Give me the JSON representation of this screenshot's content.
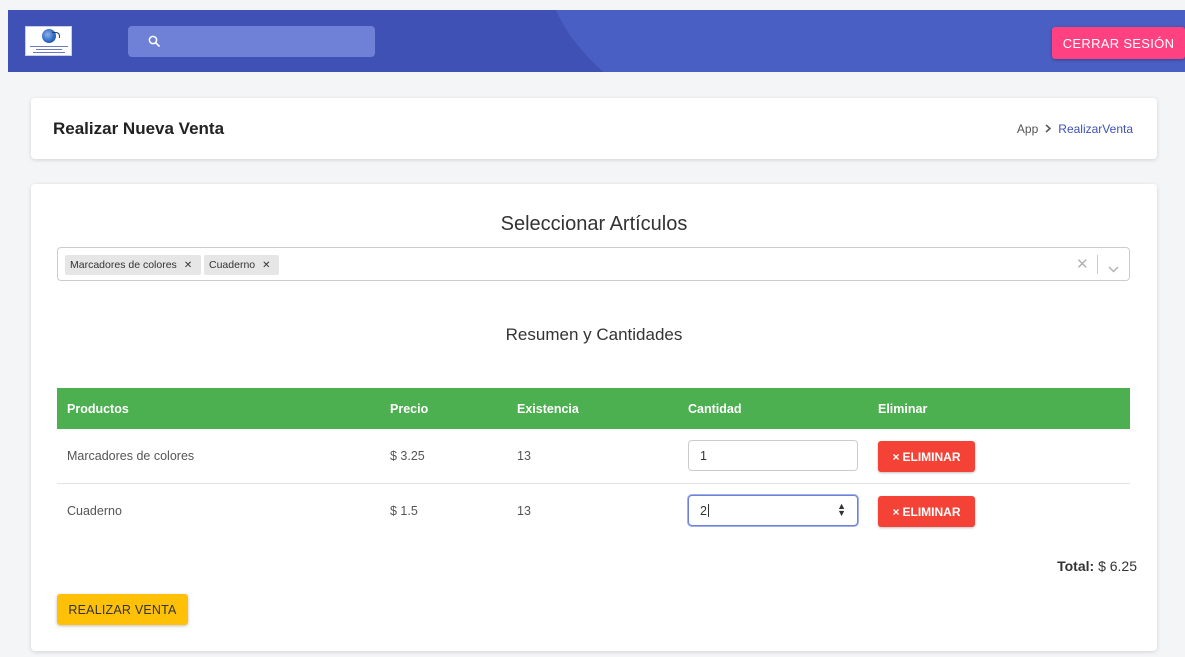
{
  "header": {
    "logout_label": "CERRAR SESIÓN",
    "search_placeholder": "",
    "accent_color": "#3f51b5",
    "logout_color": "#ff4081"
  },
  "page": {
    "title": "Realizar Nueva Venta",
    "breadcrumb": [
      "App",
      "RealizarVenta"
    ]
  },
  "selector": {
    "title": "Seleccionar Artículos",
    "selected": [
      "Marcadores de colores",
      "Cuaderno"
    ]
  },
  "summary": {
    "title": "Resumen y Cantidades",
    "columns": [
      "Productos",
      "Precio",
      "Existencia",
      "Cantidad",
      "Eliminar"
    ],
    "rows": [
      {
        "product": "Marcadores de colores",
        "price": "$ 3.25",
        "stock": "13",
        "quantity": "1",
        "delete_label": "ELIMINAR"
      },
      {
        "product": "Cuaderno",
        "price": "$ 1.5",
        "stock": "13",
        "quantity": "2",
        "delete_label": "ELIMINAR"
      }
    ],
    "total_label": "Total:",
    "total_value": "$ 6.25",
    "header_color": "#4caf50",
    "delete_color": "#f44336"
  },
  "actions": {
    "sell_label": "REALIZAR VENTA",
    "sell_color": "#ffc107"
  }
}
